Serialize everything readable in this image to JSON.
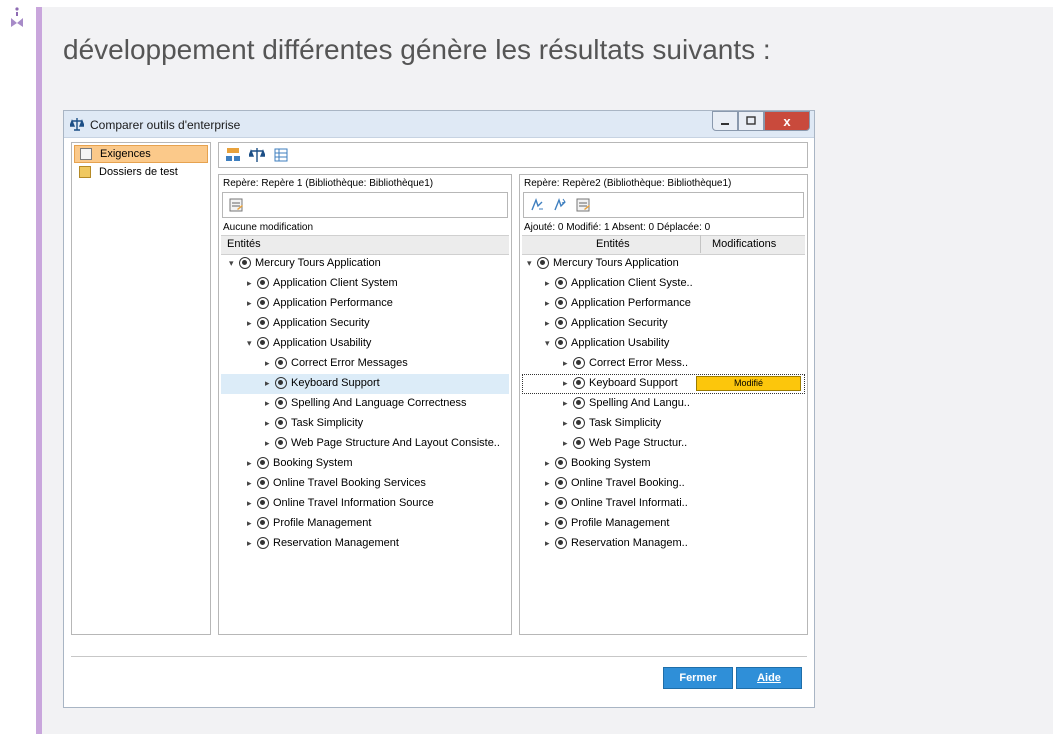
{
  "heading": "développement différentes génère les résultats suivants :",
  "window": {
    "title": "Comparer outils d'enterprise",
    "close_glyph": "x",
    "sidebar": [
      {
        "label": "Exigences",
        "icon": "requirements-icon",
        "selected": true
      },
      {
        "label": "Dossiers de test",
        "icon": "test-folders-icon",
        "selected": false
      }
    ],
    "left_pane": {
      "repere": "Repère: Repère 1 (Bibliothèque: Bibliothèque1)",
      "summary": "Aucune modification",
      "col_entities": "Entités",
      "items": [
        {
          "label": "Mercury Tours Application",
          "level": 0,
          "expanded": true
        },
        {
          "label": "Application Client System",
          "level": 1,
          "expanded": false
        },
        {
          "label": "Application Performance",
          "level": 1,
          "expanded": false
        },
        {
          "label": "Application Security",
          "level": 1,
          "expanded": false
        },
        {
          "label": "Application Usability",
          "level": 1,
          "expanded": true
        },
        {
          "label": "Correct Error Messages",
          "level": 2,
          "expanded": false
        },
        {
          "label": "Keyboard Support",
          "level": 2,
          "expanded": false,
          "highlighted": true
        },
        {
          "label": "Spelling And Language Correctness",
          "level": 2,
          "expanded": false
        },
        {
          "label": "Task Simplicity",
          "level": 2,
          "expanded": false
        },
        {
          "label": "Web Page Structure And Layout Consiste..",
          "level": 2,
          "expanded": false
        },
        {
          "label": "Booking System",
          "level": 1,
          "expanded": false
        },
        {
          "label": "Online Travel Booking Services",
          "level": 1,
          "expanded": false
        },
        {
          "label": "Online Travel Information Source",
          "level": 1,
          "expanded": false
        },
        {
          "label": "Profile Management",
          "level": 1,
          "expanded": false
        },
        {
          "label": "Reservation Management",
          "level": 1,
          "expanded": false
        }
      ]
    },
    "right_pane": {
      "repere": "Repère: Repère2 (Bibliothèque: Bibliothèque1)",
      "summary": "Ajouté: 0 Modifié: 1 Absent: 0 Déplacée: 0",
      "col_entities": "Entités",
      "col_modifications": "Modifications",
      "items": [
        {
          "label": "Mercury Tours Application",
          "level": 0,
          "expanded": true
        },
        {
          "label": "Application Client Syste..",
          "level": 1,
          "expanded": false
        },
        {
          "label": "Application Performance",
          "level": 1,
          "expanded": false
        },
        {
          "label": "Application Security",
          "level": 1,
          "expanded": false
        },
        {
          "label": "Application Usability",
          "level": 1,
          "expanded": true
        },
        {
          "label": "Correct Error Mess..",
          "level": 2,
          "expanded": false
        },
        {
          "label": "Keyboard Support",
          "level": 2,
          "expanded": false,
          "focused": true,
          "modification": "Modifié"
        },
        {
          "label": "Spelling And Langu..",
          "level": 2,
          "expanded": false
        },
        {
          "label": "Task Simplicity",
          "level": 2,
          "expanded": false
        },
        {
          "label": "Web Page Structur..",
          "level": 2,
          "expanded": false
        },
        {
          "label": "Booking System",
          "level": 1,
          "expanded": false
        },
        {
          "label": "Online Travel Booking..",
          "level": 1,
          "expanded": false
        },
        {
          "label": "Online Travel Informati..",
          "level": 1,
          "expanded": false
        },
        {
          "label": "Profile Management",
          "level": 1,
          "expanded": false
        },
        {
          "label": "Reservation Managem..",
          "level": 1,
          "expanded": false
        }
      ]
    },
    "buttons": {
      "close": "Fermer",
      "help": "Aide"
    }
  },
  "colors": {
    "accent": "#c9a6dc",
    "modified": "#fcc60c",
    "button": "#2f8fd8",
    "selection": "#fbc98a"
  }
}
